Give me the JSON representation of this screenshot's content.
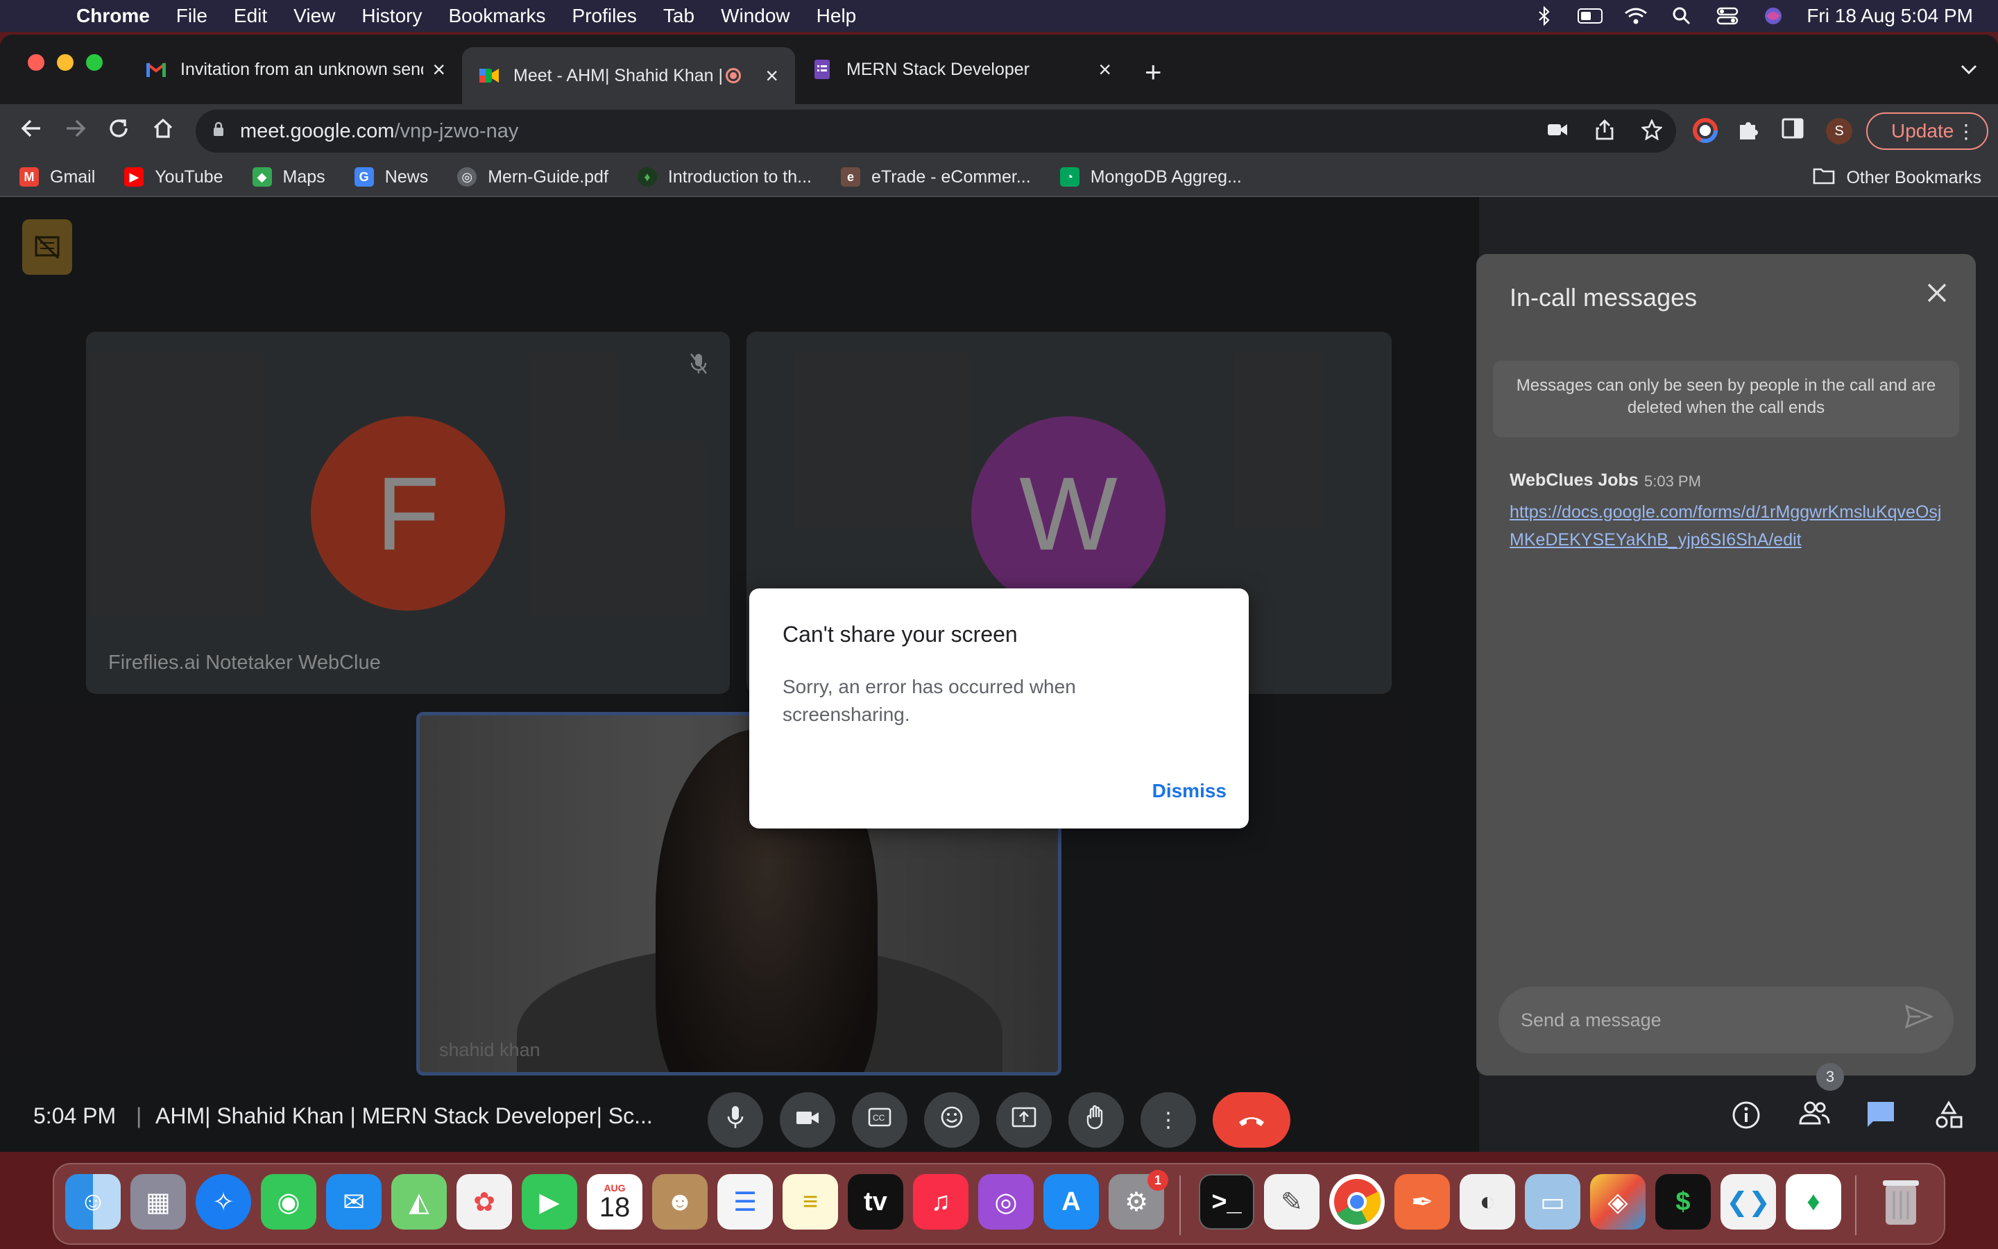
{
  "menubar": {
    "app": "Chrome",
    "items": [
      "File",
      "Edit",
      "View",
      "History",
      "Bookmarks",
      "Profiles",
      "Tab",
      "Window",
      "Help"
    ],
    "clock": "Fri 18 Aug  5:04 PM"
  },
  "tabs": [
    {
      "title": "Invitation from an unknown sender",
      "favicon": "gmail-icon"
    },
    {
      "title": "Meet - AHM| Shahid Khan | MERN Stack Developer",
      "favicon": "meet-icon"
    },
    {
      "title": "MERN Stack Developer",
      "favicon": "forms-icon"
    }
  ],
  "address": {
    "host": "meet.google.com",
    "path": "/vnp-jzwo-nay"
  },
  "toolbar": {
    "profile_initial": "S",
    "update_label": "Update"
  },
  "bookmarks": [
    {
      "label": "Gmail",
      "color": "#ea4335"
    },
    {
      "label": "YouTube",
      "color": "#ff0000"
    },
    {
      "label": "Maps",
      "color": "#34a853"
    },
    {
      "label": "News",
      "color": "#4285f4"
    },
    {
      "label": "Mern-Guide.pdf",
      "color": "#9aa0a6"
    },
    {
      "label": "Introduction to th...",
      "color": "#2e7d32"
    },
    {
      "label": "eTrade - eCommer...",
      "color": "#6d4c41"
    },
    {
      "label": "MongoDB Aggreg...",
      "color": "#00a35c"
    }
  ],
  "bookmarks_other": "Other Bookmarks",
  "tiles": {
    "tile1": {
      "initial": "F",
      "name": "Fireflies.ai Notetaker WebClue",
      "color": "#c0432a"
    },
    "tile2": {
      "initial": "W",
      "color": "#8e3a98"
    },
    "self_name": "shahid khan"
  },
  "dialog": {
    "title": "Can't share your screen",
    "body": "Sorry, an error has occurred when screensharing.",
    "dismiss": "Dismiss"
  },
  "panel": {
    "title": "In-call messages",
    "notice": "Messages can only be seen by people in the call and are deleted when the call ends",
    "message": {
      "sender": "WebClues Jobs",
      "time": "5:03 PM",
      "link": "https://docs.google.com/forms/d/1rMggwrKmsluKqveOsjMKeDEKYSEYaKhB_yjp6SI6ShA/edit"
    },
    "compose_placeholder": "Send a message"
  },
  "controls": {
    "time": "5:04 PM",
    "separator": "|",
    "meeting_name": "AHM| Shahid Khan | MERN Stack Developer| Sc...",
    "participants_count": "3"
  },
  "dock": {
    "calendar_month": "AUG",
    "calendar_day": "18",
    "settings_badge": "1"
  }
}
